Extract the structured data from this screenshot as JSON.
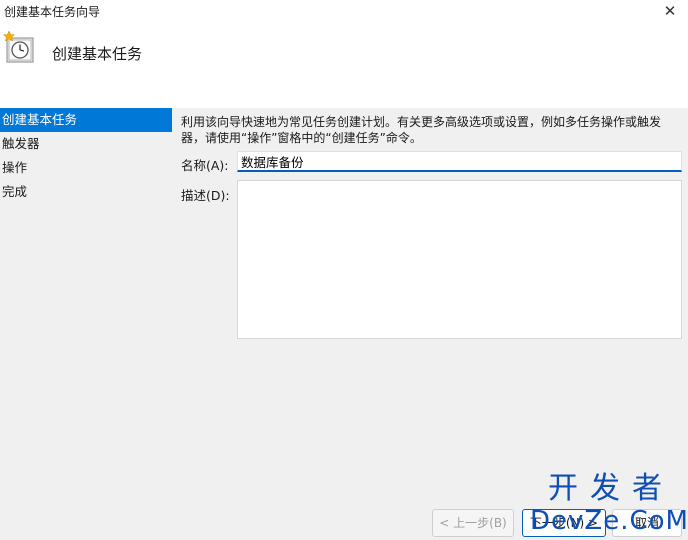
{
  "window": {
    "title": "创建基本任务向导",
    "close_glyph": "✕"
  },
  "header": {
    "title": "创建基本任务",
    "icon": "scheduled-task-clock-icon"
  },
  "sidebar": {
    "items": [
      {
        "label": "创建基本任务",
        "active": true
      },
      {
        "label": "触发器",
        "active": false
      },
      {
        "label": "操作",
        "active": false
      },
      {
        "label": "完成",
        "active": false
      }
    ]
  },
  "main": {
    "intro": "利用该向导快速地为常见任务创建计划。有关更多高级选项或设置，例如多任务操作或触发器，请使用“操作”窗格中的“创建任务”命令。",
    "name_label": "名称(A):",
    "name_value": "数据库备份",
    "description_label": "描述(D):",
    "description_value": ""
  },
  "buttons": {
    "back": "< 上一步(B)",
    "next": "下一步(N) >",
    "cancel": "取消"
  },
  "watermark": {
    "line1": "开发者",
    "line2": "DevZe.CoM"
  },
  "colors": {
    "accent": "#0078d7",
    "input_underline": "#005fb8",
    "watermark": "#0f4fb5"
  }
}
